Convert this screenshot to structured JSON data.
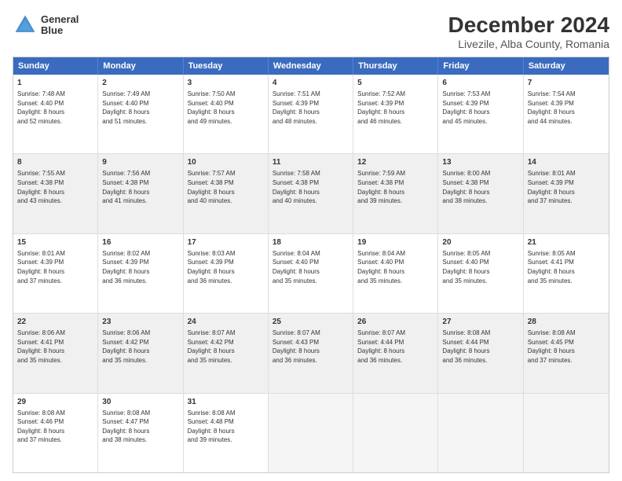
{
  "header": {
    "logo_line1": "General",
    "logo_line2": "Blue",
    "main_title": "December 2024",
    "subtitle": "Livezile, Alba County, Romania"
  },
  "calendar": {
    "days_of_week": [
      "Sunday",
      "Monday",
      "Tuesday",
      "Wednesday",
      "Thursday",
      "Friday",
      "Saturday"
    ],
    "rows": [
      [
        {
          "day": "1",
          "lines": [
            "Sunrise: 7:48 AM",
            "Sunset: 4:40 PM",
            "Daylight: 8 hours",
            "and 52 minutes."
          ],
          "shaded": false
        },
        {
          "day": "2",
          "lines": [
            "Sunrise: 7:49 AM",
            "Sunset: 4:40 PM",
            "Daylight: 8 hours",
            "and 51 minutes."
          ],
          "shaded": false
        },
        {
          "day": "3",
          "lines": [
            "Sunrise: 7:50 AM",
            "Sunset: 4:40 PM",
            "Daylight: 8 hours",
            "and 49 minutes."
          ],
          "shaded": false
        },
        {
          "day": "4",
          "lines": [
            "Sunrise: 7:51 AM",
            "Sunset: 4:39 PM",
            "Daylight: 8 hours",
            "and 48 minutes."
          ],
          "shaded": false
        },
        {
          "day": "5",
          "lines": [
            "Sunrise: 7:52 AM",
            "Sunset: 4:39 PM",
            "Daylight: 8 hours",
            "and 46 minutes."
          ],
          "shaded": false
        },
        {
          "day": "6",
          "lines": [
            "Sunrise: 7:53 AM",
            "Sunset: 4:39 PM",
            "Daylight: 8 hours",
            "and 45 minutes."
          ],
          "shaded": false
        },
        {
          "day": "7",
          "lines": [
            "Sunrise: 7:54 AM",
            "Sunset: 4:39 PM",
            "Daylight: 8 hours",
            "and 44 minutes."
          ],
          "shaded": false
        }
      ],
      [
        {
          "day": "8",
          "lines": [
            "Sunrise: 7:55 AM",
            "Sunset: 4:38 PM",
            "Daylight: 8 hours",
            "and 43 minutes."
          ],
          "shaded": true
        },
        {
          "day": "9",
          "lines": [
            "Sunrise: 7:56 AM",
            "Sunset: 4:38 PM",
            "Daylight: 8 hours",
            "and 41 minutes."
          ],
          "shaded": true
        },
        {
          "day": "10",
          "lines": [
            "Sunrise: 7:57 AM",
            "Sunset: 4:38 PM",
            "Daylight: 8 hours",
            "and 40 minutes."
          ],
          "shaded": true
        },
        {
          "day": "11",
          "lines": [
            "Sunrise: 7:58 AM",
            "Sunset: 4:38 PM",
            "Daylight: 8 hours",
            "and 40 minutes."
          ],
          "shaded": true
        },
        {
          "day": "12",
          "lines": [
            "Sunrise: 7:59 AM",
            "Sunset: 4:38 PM",
            "Daylight: 8 hours",
            "and 39 minutes."
          ],
          "shaded": true
        },
        {
          "day": "13",
          "lines": [
            "Sunrise: 8:00 AM",
            "Sunset: 4:38 PM",
            "Daylight: 8 hours",
            "and 38 minutes."
          ],
          "shaded": true
        },
        {
          "day": "14",
          "lines": [
            "Sunrise: 8:01 AM",
            "Sunset: 4:39 PM",
            "Daylight: 8 hours",
            "and 37 minutes."
          ],
          "shaded": true
        }
      ],
      [
        {
          "day": "15",
          "lines": [
            "Sunrise: 8:01 AM",
            "Sunset: 4:39 PM",
            "Daylight: 8 hours",
            "and 37 minutes."
          ],
          "shaded": false
        },
        {
          "day": "16",
          "lines": [
            "Sunrise: 8:02 AM",
            "Sunset: 4:39 PM",
            "Daylight: 8 hours",
            "and 36 minutes."
          ],
          "shaded": false
        },
        {
          "day": "17",
          "lines": [
            "Sunrise: 8:03 AM",
            "Sunset: 4:39 PM",
            "Daylight: 8 hours",
            "and 36 minutes."
          ],
          "shaded": false
        },
        {
          "day": "18",
          "lines": [
            "Sunrise: 8:04 AM",
            "Sunset: 4:40 PM",
            "Daylight: 8 hours",
            "and 35 minutes."
          ],
          "shaded": false
        },
        {
          "day": "19",
          "lines": [
            "Sunrise: 8:04 AM",
            "Sunset: 4:40 PM",
            "Daylight: 8 hours",
            "and 35 minutes."
          ],
          "shaded": false
        },
        {
          "day": "20",
          "lines": [
            "Sunrise: 8:05 AM",
            "Sunset: 4:40 PM",
            "Daylight: 8 hours",
            "and 35 minutes."
          ],
          "shaded": false
        },
        {
          "day": "21",
          "lines": [
            "Sunrise: 8:05 AM",
            "Sunset: 4:41 PM",
            "Daylight: 8 hours",
            "and 35 minutes."
          ],
          "shaded": false
        }
      ],
      [
        {
          "day": "22",
          "lines": [
            "Sunrise: 8:06 AM",
            "Sunset: 4:41 PM",
            "Daylight: 8 hours",
            "and 35 minutes."
          ],
          "shaded": true
        },
        {
          "day": "23",
          "lines": [
            "Sunrise: 8:06 AM",
            "Sunset: 4:42 PM",
            "Daylight: 8 hours",
            "and 35 minutes."
          ],
          "shaded": true
        },
        {
          "day": "24",
          "lines": [
            "Sunrise: 8:07 AM",
            "Sunset: 4:42 PM",
            "Daylight: 8 hours",
            "and 35 minutes."
          ],
          "shaded": true
        },
        {
          "day": "25",
          "lines": [
            "Sunrise: 8:07 AM",
            "Sunset: 4:43 PM",
            "Daylight: 8 hours",
            "and 36 minutes."
          ],
          "shaded": true
        },
        {
          "day": "26",
          "lines": [
            "Sunrise: 8:07 AM",
            "Sunset: 4:44 PM",
            "Daylight: 8 hours",
            "and 36 minutes."
          ],
          "shaded": true
        },
        {
          "day": "27",
          "lines": [
            "Sunrise: 8:08 AM",
            "Sunset: 4:44 PM",
            "Daylight: 8 hours",
            "and 36 minutes."
          ],
          "shaded": true
        },
        {
          "day": "28",
          "lines": [
            "Sunrise: 8:08 AM",
            "Sunset: 4:45 PM",
            "Daylight: 8 hours",
            "and 37 minutes."
          ],
          "shaded": true
        }
      ],
      [
        {
          "day": "29",
          "lines": [
            "Sunrise: 8:08 AM",
            "Sunset: 4:46 PM",
            "Daylight: 8 hours",
            "and 37 minutes."
          ],
          "shaded": false
        },
        {
          "day": "30",
          "lines": [
            "Sunrise: 8:08 AM",
            "Sunset: 4:47 PM",
            "Daylight: 8 hours",
            "and 38 minutes."
          ],
          "shaded": false
        },
        {
          "day": "31",
          "lines": [
            "Sunrise: 8:08 AM",
            "Sunset: 4:48 PM",
            "Daylight: 8 hours",
            "and 39 minutes."
          ],
          "shaded": false
        },
        {
          "day": "",
          "lines": [],
          "shaded": false,
          "empty": true
        },
        {
          "day": "",
          "lines": [],
          "shaded": false,
          "empty": true
        },
        {
          "day": "",
          "lines": [],
          "shaded": false,
          "empty": true
        },
        {
          "day": "",
          "lines": [],
          "shaded": false,
          "empty": true
        }
      ]
    ]
  }
}
